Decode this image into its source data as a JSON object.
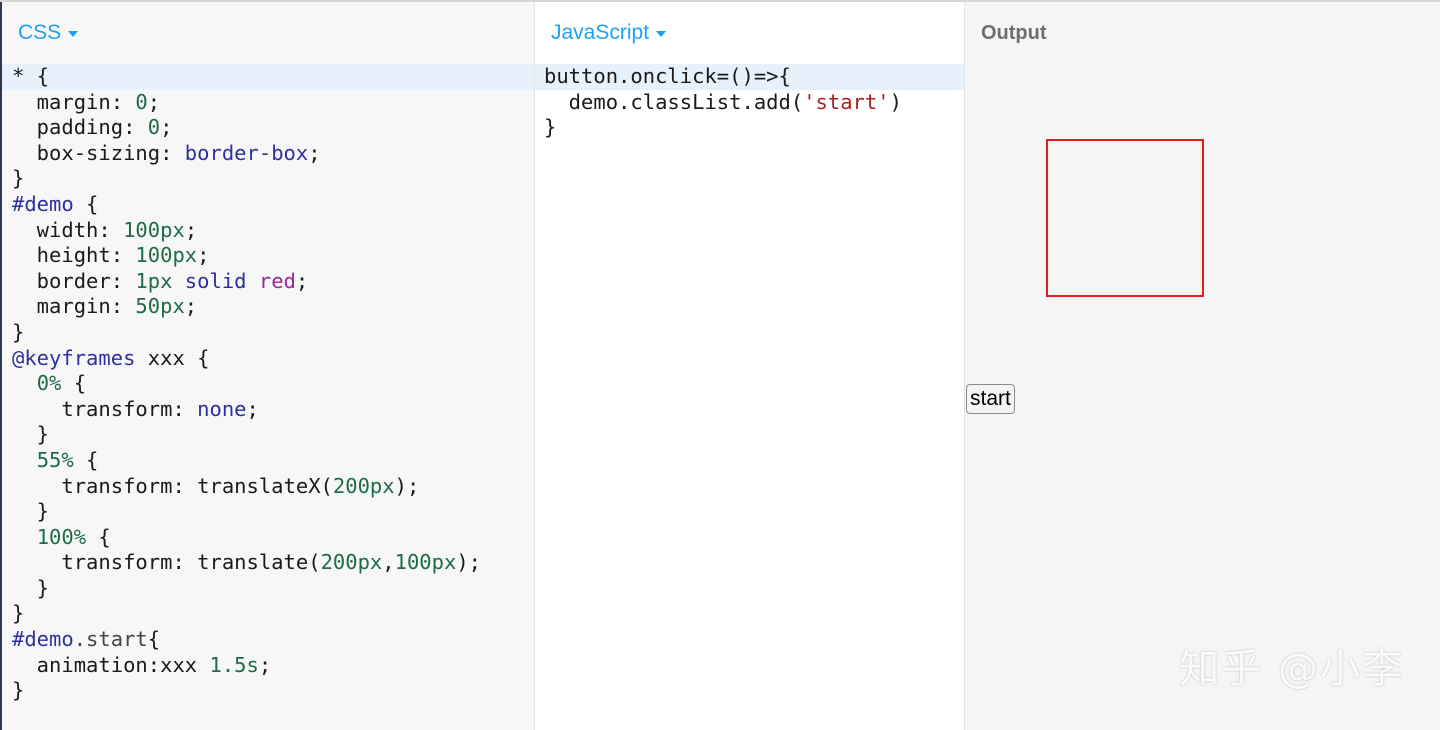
{
  "css_pane": {
    "language_label": "CSS",
    "code_lines": [
      "* {",
      "  margin: 0;",
      "  padding: 0;",
      "  box-sizing: border-box;",
      "}",
      "#demo {",
      "  width: 100px;",
      "  height: 100px;",
      "  border: 1px solid red;",
      "  margin: 50px;",
      "}",
      "@keyframes xxx {",
      "  0% {",
      "    transform: none;",
      "  }",
      "  55% {",
      "    transform: translateX(200px);",
      "  }",
      "  100% {",
      "    transform: translate(200px,100px);",
      "  }",
      "}",
      "#demo.start{",
      "  animation:xxx 1.5s;",
      "}"
    ]
  },
  "js_pane": {
    "language_label": "JavaScript",
    "code_lines": [
      "button.onclick=()=>{",
      "  demo.classList.add('start')",
      "}"
    ]
  },
  "output_pane": {
    "title": "Output",
    "button_label": "start",
    "demo_border_color": "#e02020"
  },
  "watermark": "知乎 @小李",
  "colors": {
    "accent": "#1da1f2",
    "active_line": "#e6f1fb"
  }
}
